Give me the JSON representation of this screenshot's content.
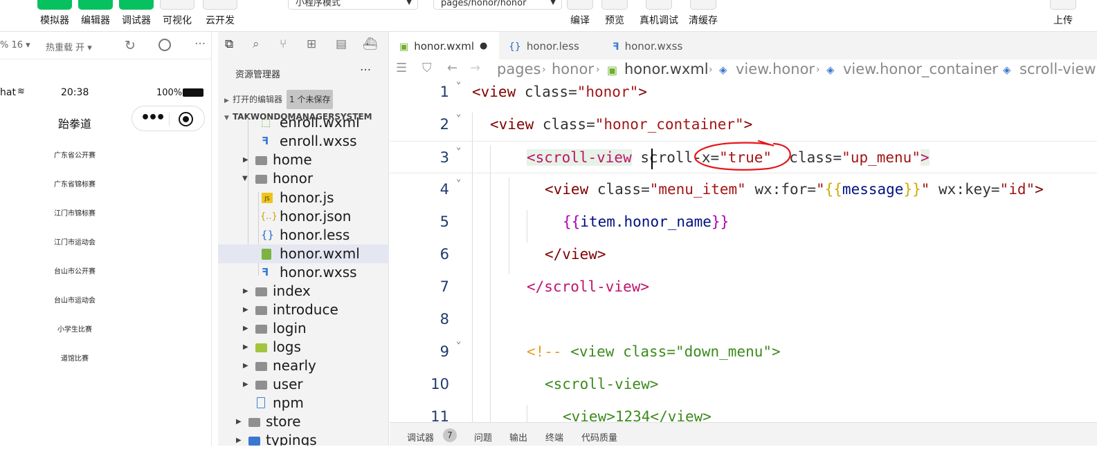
{
  "toolbar": {
    "left_buttons": [
      "模拟器",
      "编辑器",
      "调试器",
      "可视化",
      "云开发"
    ],
    "mode_select": "小程序模式",
    "page_select": "pages/honor/honor",
    "right_buttons": [
      "编译",
      "预览",
      "真机调试",
      "清缓存"
    ],
    "upload": "上传"
  },
  "simulator": {
    "zoom": "% 16",
    "hot_reload": "热重载 开",
    "status_left": "hat",
    "time": "20:38",
    "battery": "100%",
    "nav_title": "跆拳道",
    "honor_items": [
      "广东省公开赛",
      "广东省锦标赛",
      "江门市锦标赛",
      "江门市运动会",
      "台山市公开赛",
      "台山市运动会",
      "小学生比赛",
      "道馆比赛"
    ]
  },
  "explorer": {
    "title": "资源管理器",
    "more": "···",
    "open_editors": "打开的编辑器",
    "unsaved_badge": "1 个未保存",
    "project": "TAKWONDOMANAGERSYSTEM",
    "tree": [
      {
        "name": "enroll.wxml",
        "icon": "wxml-file-icon"
      },
      {
        "name": "enroll.wxss",
        "icon": "wxss-file-icon"
      },
      {
        "name": "home",
        "icon": "folder-icon"
      },
      {
        "name": "honor",
        "icon": "folder-open-icon"
      },
      {
        "name": "honor.js",
        "icon": "js-file-icon"
      },
      {
        "name": "honor.json",
        "icon": "json-file-icon"
      },
      {
        "name": "honor.less",
        "icon": "less-file-icon"
      },
      {
        "name": "honor.wxml",
        "icon": "wxml-file-icon"
      },
      {
        "name": "honor.wxss",
        "icon": "wxss-file-icon"
      },
      {
        "name": "index",
        "icon": "folder-icon"
      },
      {
        "name": "introduce",
        "icon": "folder-icon"
      },
      {
        "name": "login",
        "icon": "folder-icon"
      },
      {
        "name": "logs",
        "icon": "folder-logs-icon"
      },
      {
        "name": "nearly",
        "icon": "folder-icon"
      },
      {
        "name": "user",
        "icon": "folder-icon"
      },
      {
        "name": "npm",
        "icon": "file-icon"
      },
      {
        "name": "store",
        "icon": "folder-icon"
      },
      {
        "name": "typings",
        "icon": "folder-blue-icon"
      }
    ]
  },
  "editor": {
    "tabs": [
      {
        "label": "honor.wxml",
        "icon": "wxml-file-icon",
        "dirty": "●"
      },
      {
        "label": "honor.less",
        "icon": "less-file-icon"
      },
      {
        "label": "honor.wxss",
        "icon": "wxss-file-icon"
      }
    ],
    "breadcrumbs": [
      "pages",
      "honor",
      "honor.wxml",
      "view.honor",
      "view.honor_container",
      "scroll-view"
    ],
    "line_numbers": [
      "1",
      "2",
      "3",
      "4",
      "5",
      "6",
      "7",
      "8",
      "9",
      "10",
      "11"
    ],
    "code": {
      "l1": {
        "open": "<view",
        "attr": " class=",
        "val": "\"honor\"",
        "close": ">"
      },
      "l2": {
        "open": "<view",
        "attr": " class=",
        "val": "\"honor_container\"",
        "close": ">"
      },
      "l3": {
        "open": "<scroll-view",
        "attr1": " scroll-x=",
        "val1": "\"true\"",
        "attr2": "  class=",
        "val2": "\"up_menu\"",
        "close": ">"
      },
      "l4": {
        "open": "<view",
        "attr1": " class=",
        "val1": "\"menu_item\"",
        "attr2": " wx:for=",
        "q1": "\"",
        "b1": "{{",
        "var": "message",
        "b2": "}}",
        "q2": "\"",
        "attr3": " wx:key=",
        "val3": "\"id\"",
        "close": ">"
      },
      "l5": {
        "b1": "{{",
        "var": "item.honor_name",
        "b2": "}}"
      },
      "l6": {
        "text": "</view>"
      },
      "l7": {
        "text": "</scroll-view>"
      },
      "l9": {
        "cmt": "<!--",
        "open": " <view",
        "attr": " class=",
        "val": "\"down_menu\"",
        "close": ">"
      },
      "l10": {
        "text": "<scroll-view>"
      },
      "l11": {
        "text": "<view>1234</view>"
      }
    }
  },
  "bottom_panel": {
    "debugger": "调试器",
    "count": "7",
    "problems": "问题",
    "output": "输出",
    "terminal": "终端",
    "code_quality": "代码质量"
  },
  "colors": {
    "accent_green": "#07c160",
    "annotation_red": "#e8141c"
  }
}
